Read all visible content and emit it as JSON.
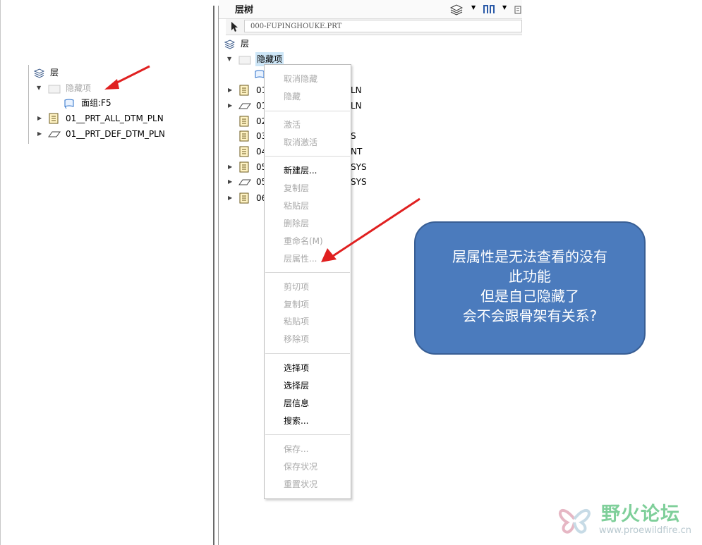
{
  "left_tree": {
    "root_label": "层",
    "hidden_item": "隐藏项",
    "hidden_child": "面组:F5",
    "layers": [
      "01__PRT_ALL_DTM_PLN",
      "01__PRT_DEF_DTM_PLN"
    ]
  },
  "right_panel": {
    "title": "层树",
    "model_name": "000-FUPINGHOUKE.PRT",
    "root_label": "层",
    "hidden_item": "隐藏项",
    "row_prefixes": [
      "01",
      "01",
      "02",
      "03",
      "04",
      "05",
      "05",
      "06"
    ],
    "row_suffixes": [
      "LN",
      "LN",
      "S",
      "NT",
      "SYS",
      "SYS"
    ]
  },
  "context_menu": {
    "group1": [
      "取消隐藏",
      "隐藏"
    ],
    "group2": [
      "激活",
      "取消激活"
    ],
    "group3": [
      "新建层...",
      "复制层",
      "粘贴层",
      "删除层",
      "重命名(M)",
      "层属性..."
    ],
    "group4": [
      "剪切项",
      "复制项",
      "粘贴项",
      "移除项"
    ],
    "group5": [
      "选择项",
      "选择层",
      "层信息",
      "搜索..."
    ],
    "group6": [
      "保存...",
      "保存状况",
      "重置状况"
    ]
  },
  "callout": {
    "lines": [
      "层属性是无法查看的没有",
      "此功能",
      "但是自己隐藏了",
      "会不会跟骨架有关系?"
    ]
  },
  "watermark": {
    "name": "野火论坛",
    "url": "www.proewildfire.cn"
  },
  "colors": {
    "callout_fill": "#4b7bbd",
    "arrow_red": "#e02020",
    "watermark_green": "#7fcf9a"
  }
}
